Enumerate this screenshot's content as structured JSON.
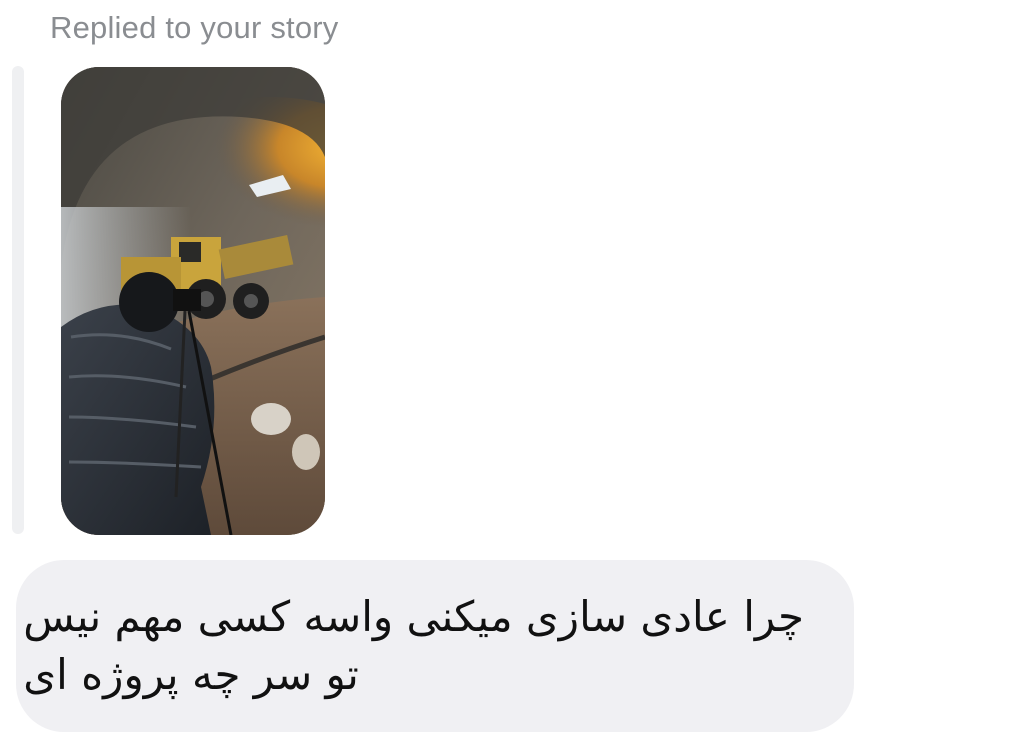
{
  "reply": {
    "label": "Replied to your story"
  },
  "story": {
    "image_description": "story-photo"
  },
  "message": {
    "text": "چرا عادی سازی میکنی واسه کسی مهم نیس\nتو سر چه پروژه ای"
  }
}
